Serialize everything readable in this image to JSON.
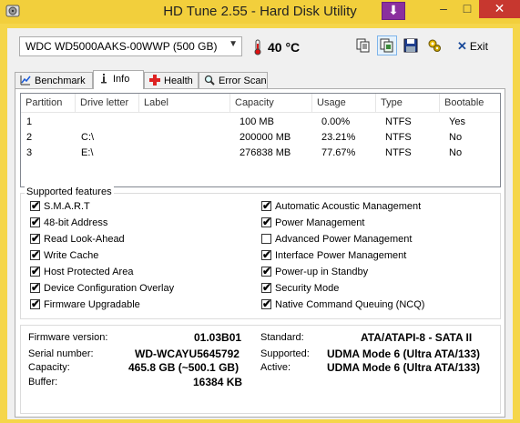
{
  "window": {
    "title": "HD Tune 2.55 - Hard Disk Utility",
    "colors": {
      "titlebar": "#f2cf3c",
      "close": "#c7372f",
      "accent_button": "#8b2f9e"
    }
  },
  "toolbar": {
    "drive": "WDC WD5000AAKS-00WWP (500 GB)",
    "temperature": "40 °C",
    "icons": [
      "copy-text-icon",
      "copy-screenshot-icon",
      "save-icon",
      "options-icon"
    ],
    "exit_label": "Exit"
  },
  "tabs": [
    {
      "label": "Benchmark",
      "icon": "benchmark-icon"
    },
    {
      "label": "Info",
      "icon": "info-icon",
      "active": true
    },
    {
      "label": "Health",
      "icon": "health-icon"
    },
    {
      "label": "Error Scan",
      "icon": "magnifier-icon"
    }
  ],
  "partitions": {
    "headers": [
      "Partition",
      "Drive letter",
      "Label",
      "Capacity",
      "Usage",
      "Type",
      "Bootable"
    ],
    "rows": [
      [
        "1",
        "",
        "",
        "100 MB",
        "0.00%",
        "NTFS",
        "Yes"
      ],
      [
        "2",
        "C:\\",
        "",
        "200000 MB",
        "23.21%",
        "NTFS",
        "No"
      ],
      [
        "3",
        "E:\\",
        "",
        "276838 MB",
        "77.67%",
        "NTFS",
        "No"
      ]
    ]
  },
  "features": {
    "title": "Supported features",
    "left": [
      {
        "label": "S.M.A.R.T",
        "checked": true
      },
      {
        "label": "48-bit Address",
        "checked": true
      },
      {
        "label": "Read Look-Ahead",
        "checked": true
      },
      {
        "label": "Write Cache",
        "checked": true
      },
      {
        "label": "Host Protected Area",
        "checked": true
      },
      {
        "label": "Device Configuration Overlay",
        "checked": true
      },
      {
        "label": "Firmware Upgradable",
        "checked": true
      }
    ],
    "right": [
      {
        "label": "Automatic Acoustic Management",
        "checked": true
      },
      {
        "label": "Power Management",
        "checked": true
      },
      {
        "label": "Advanced Power Management",
        "checked": false
      },
      {
        "label": "Interface Power Management",
        "checked": true
      },
      {
        "label": "Power-up in Standby",
        "checked": true
      },
      {
        "label": "Security Mode",
        "checked": true
      },
      {
        "label": "Native Command Queuing (NCQ)",
        "checked": true
      }
    ]
  },
  "details": {
    "firmware_label": "Firmware version:",
    "firmware": "01.03B01",
    "serial_label": "Serial number:",
    "serial": "WD-WCAYU5645792",
    "capacity_label": "Capacity:",
    "capacity": "465.8 GB (~500.1 GB)",
    "buffer_label": "Buffer:",
    "buffer": "16384 KB",
    "standard_label": "Standard:",
    "standard": "ATA/ATAPI-8 - SATA II",
    "supported_label": "Supported:",
    "supported": "UDMA Mode 6 (Ultra ATA/133)",
    "active_label": "Active:",
    "active": "UDMA Mode 6 (Ultra ATA/133)"
  }
}
